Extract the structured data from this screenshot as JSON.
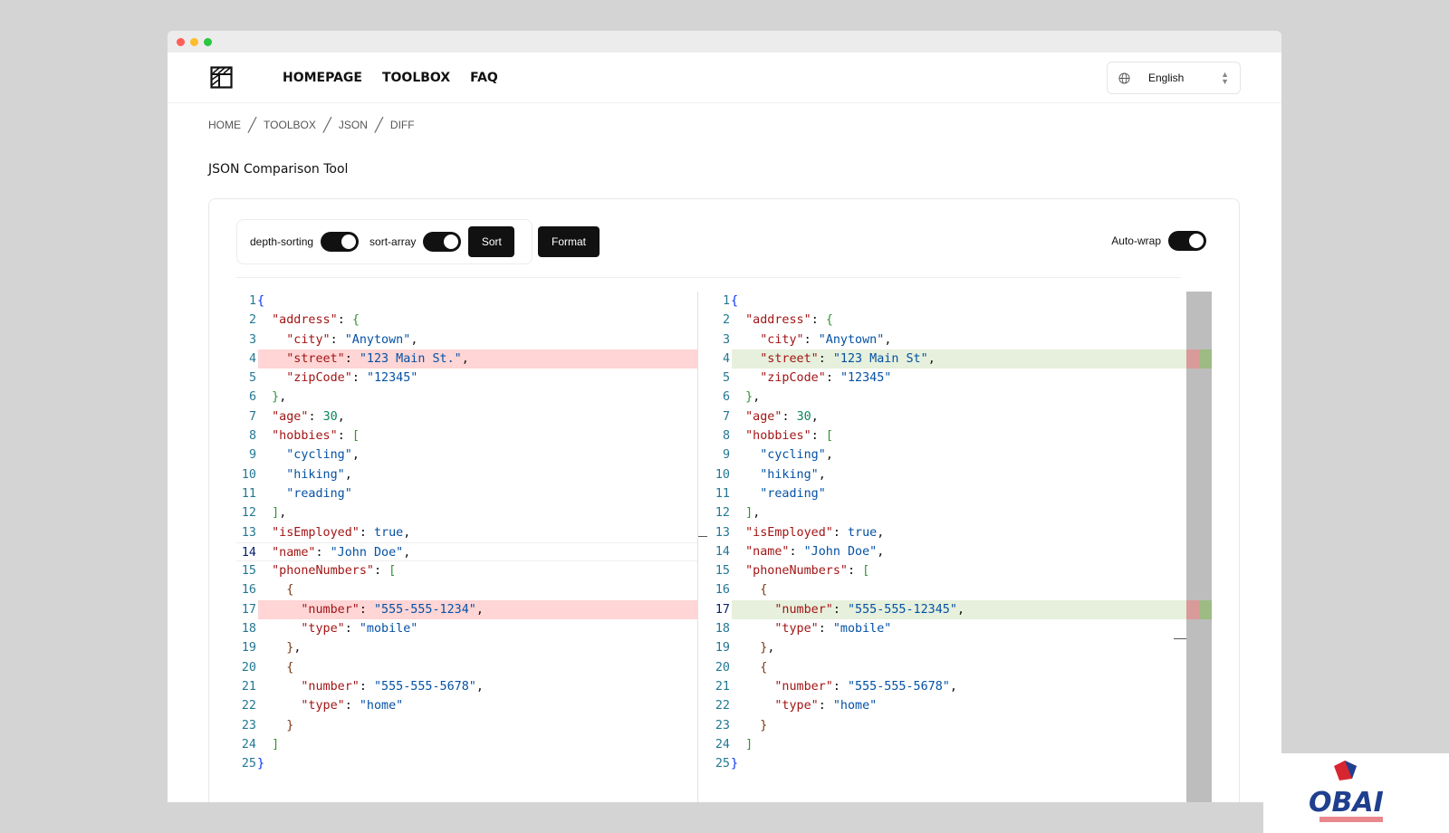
{
  "nav": {
    "links": [
      "HOMEPAGE",
      "TOOLBOX",
      "FAQ"
    ],
    "language": "English"
  },
  "breadcrumb": [
    "HOME",
    "TOOLBOX",
    "JSON",
    "DIFF"
  ],
  "page_title": "JSON Comparison Tool",
  "options": {
    "depth_sorting_label": "depth-sorting",
    "depth_sorting_on": true,
    "sort_array_label": "sort-array",
    "sort_array_on": true,
    "sort_button": "Sort",
    "format_button": "Format",
    "auto_wrap_label": "Auto-wrap",
    "auto_wrap_on": true
  },
  "left_editor": {
    "lines": [
      "{",
      "  \"address\": {",
      "    \"city\": \"Anytown\",",
      "    \"street\": \"123 Main St.\",",
      "    \"zipCode\": \"12345\"",
      "  },",
      "  \"age\": 30,",
      "  \"hobbies\": [",
      "    \"cycling\",",
      "    \"hiking\",",
      "    \"reading\"",
      "  ],",
      "  \"isEmployed\": true,",
      "  \"name\": \"John Doe\",",
      "  \"phoneNumbers\": [",
      "    {",
      "      \"number\": \"555-555-1234\",",
      "      \"type\": \"mobile\"",
      "    },",
      "    {",
      "      \"number\": \"555-555-5678\",",
      "      \"type\": \"home\"",
      "    }",
      "  ]",
      "}"
    ],
    "changed_lines": [
      4,
      17
    ]
  },
  "right_editor": {
    "lines": [
      "{",
      "  \"address\": {",
      "    \"city\": \"Anytown\",",
      "    \"street\": \"123 Main St\",",
      "    \"zipCode\": \"12345\"",
      "  },",
      "  \"age\": 30,",
      "  \"hobbies\": [",
      "    \"cycling\",",
      "    \"hiking\",",
      "    \"reading\"",
      "  ],",
      "  \"isEmployed\": true,",
      "  \"name\": \"John Doe\",",
      "  \"phoneNumbers\": [",
      "    {",
      "      \"number\": \"555-555-12345\",",
      "      \"type\": \"mobile\"",
      "    },",
      "    {",
      "      \"number\": \"555-555-5678\",",
      "      \"type\": \"home\"",
      "    }",
      "  ]",
      "}"
    ],
    "changed_lines": [
      4,
      17
    ]
  },
  "colors": {
    "deleted_bg": "#ffd5d5",
    "inserted_bg": "#e6f0dc",
    "key": "#a31515",
    "string": "#0451a5",
    "number": "#098658",
    "line_number": "#237893"
  },
  "icons": {
    "logo": "film-clapper-icon",
    "language": "globe-icon",
    "select": "chevron-updown-icon"
  }
}
